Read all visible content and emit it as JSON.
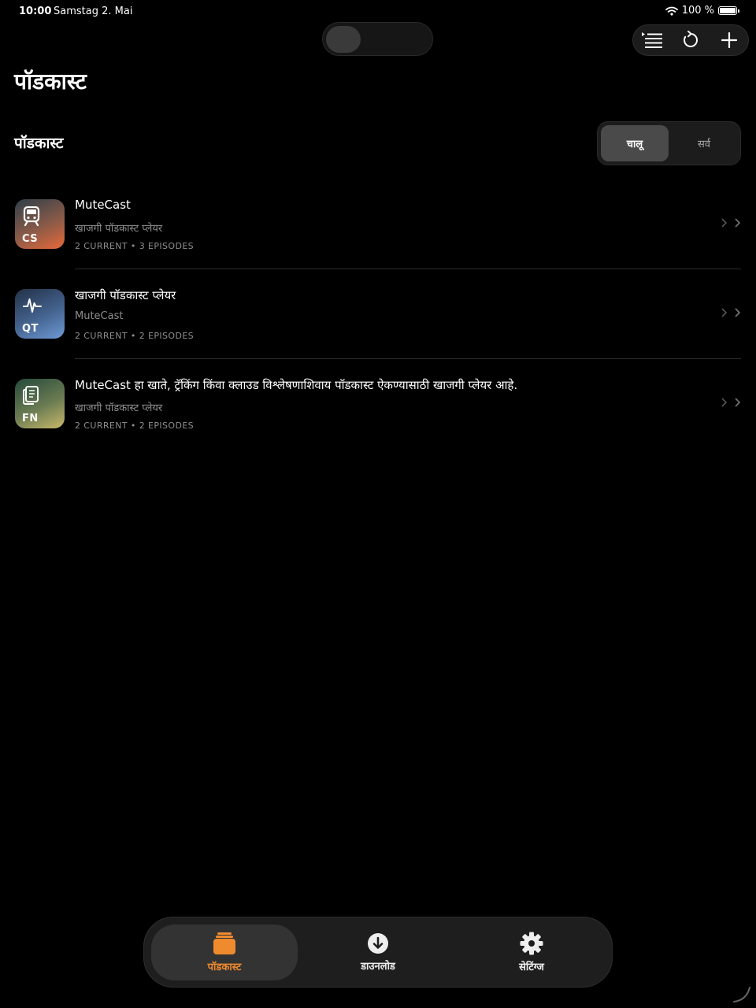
{
  "status_bar": {
    "time": "10:00",
    "date": "Samstag 2. Mai",
    "battery": "100 %"
  },
  "toolbar": {
    "icons": [
      "list-icon",
      "refresh-icon",
      "plus-icon"
    ]
  },
  "page_title": "पॉडकास्ट",
  "section": {
    "title": "पॉडकास्ट"
  },
  "filter": {
    "active": "चालू",
    "all": "सर्व"
  },
  "podcasts": [
    {
      "title": "MuteCast",
      "subtitle": "खाजगी पॉडकास्ट प्लेयर",
      "meta": "2 CURRENT • 3 EPISODES",
      "art_code": "CS",
      "art_icon": "train-icon",
      "art_colors": [
        "#2e3f4a",
        "#e8693a"
      ]
    },
    {
      "title": "खाजगी पॉडकास्ट प्लेयर",
      "subtitle": "MuteCast",
      "meta": "2 CURRENT • 2 EPISODES",
      "art_code": "QT",
      "art_icon": "waveform-icon",
      "art_colors": [
        "#233146",
        "#6f9ad6"
      ]
    },
    {
      "title": "MuteCast हा खाते, ट्रॅकिंग किंवा क्लाउड विश्लेषणाशिवाय पॉडकास्ट ऐकण्यासाठी खाजगी प्लेयर आहे.",
      "subtitle": "खाजगी पॉडकास्ट प्लेयर",
      "meta": "2 CURRENT • 2 EPISODES",
      "art_code": "FN",
      "art_icon": "document-icon",
      "art_colors": [
        "#24493a",
        "#c8b96a"
      ]
    }
  ],
  "tabs": [
    {
      "label": "पॉडकास्ट",
      "icon": "podcasts-icon",
      "active": true
    },
    {
      "label": "डाउनलोड",
      "icon": "download-icon",
      "active": false
    },
    {
      "label": "सेटिंग्ज",
      "icon": "gear-icon",
      "active": false
    }
  ],
  "colors": {
    "accent": "#f08a2e",
    "background": "#000000"
  }
}
